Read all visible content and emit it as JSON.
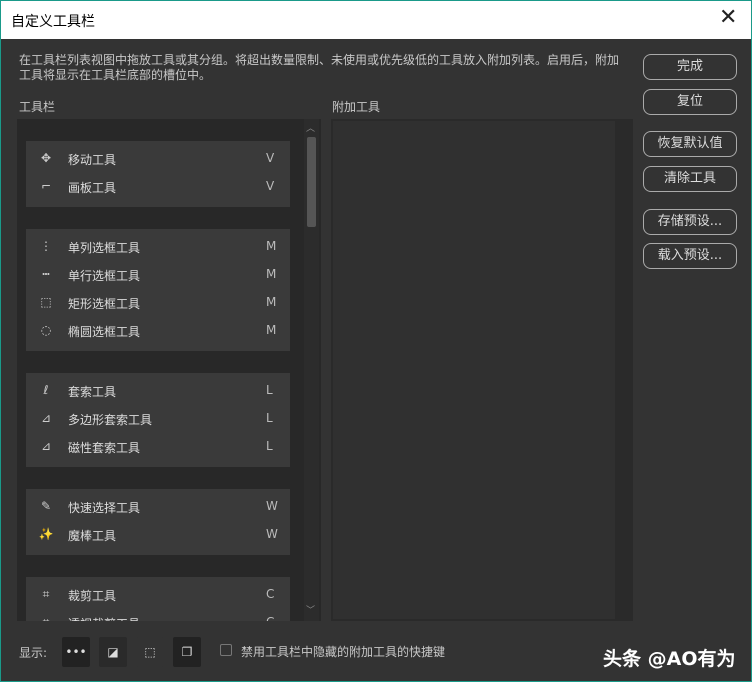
{
  "title": "自定义工具栏",
  "description": "在工具栏列表视图中拖放工具或其分组。将超出数量限制、未使用或优先级低的工具放入附加列表。启用后，附加工具将显示在工具栏底部的槽位中。",
  "toolbar_label": "工具栏",
  "extra_label": "附加工具",
  "groups": [
    [
      {
        "name": "移动工具",
        "key": "V",
        "icon": "move-icon"
      },
      {
        "name": "画板工具",
        "key": "V",
        "icon": "artboard-icon"
      }
    ],
    [
      {
        "name": "单列选框工具",
        "key": "M",
        "icon": "single-column-marquee-icon"
      },
      {
        "name": "单行选框工具",
        "key": "M",
        "icon": "single-row-marquee-icon"
      },
      {
        "name": "矩形选框工具",
        "key": "M",
        "icon": "rect-marquee-icon"
      },
      {
        "name": "椭圆选框工具",
        "key": "M",
        "icon": "ellipse-marquee-icon"
      }
    ],
    [
      {
        "name": "套索工具",
        "key": "L",
        "icon": "lasso-icon"
      },
      {
        "name": "多边形套索工具",
        "key": "L",
        "icon": "polygon-lasso-icon"
      },
      {
        "name": "磁性套索工具",
        "key": "L",
        "icon": "magnetic-lasso-icon"
      }
    ],
    [
      {
        "name": "快速选择工具",
        "key": "W",
        "icon": "quick-select-icon"
      },
      {
        "name": "魔棒工具",
        "key": "W",
        "icon": "magic-wand-icon"
      }
    ],
    [
      {
        "name": "裁剪工具",
        "key": "C",
        "icon": "crop-icon"
      },
      {
        "name": "透视裁剪工具",
        "key": "C",
        "icon": "perspective-crop-icon"
      }
    ]
  ],
  "buttons": {
    "done": "完成",
    "reset": "复位",
    "restore": "恢复默认值",
    "clear": "清除工具",
    "save": "存储预设...",
    "load": "载入预设..."
  },
  "footer": {
    "show_label": "显示:",
    "checkbox_label": "禁用工具栏中隐藏的附加工具的快捷键",
    "checked": false
  },
  "watermark": "头条 @AO有为"
}
